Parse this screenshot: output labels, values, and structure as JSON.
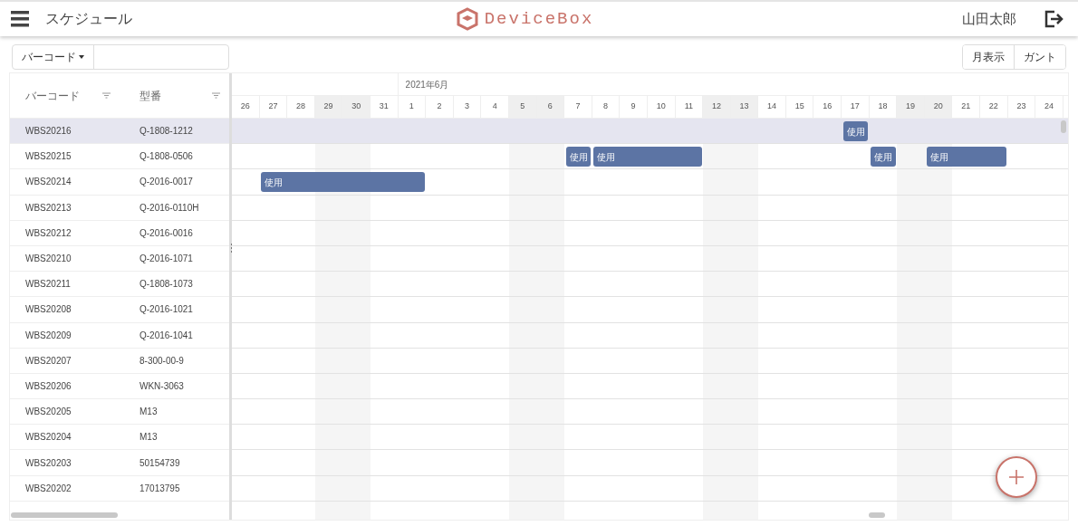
{
  "header": {
    "title": "スケジュール",
    "logo": "DeviceBox",
    "user": "山田太郎"
  },
  "toolbar": {
    "filter_dropdown": "バーコード",
    "view_buttons": [
      {
        "label": "月表示",
        "selected": false
      },
      {
        "label": "ガント",
        "selected": false
      }
    ]
  },
  "table": {
    "columns": [
      "バーコード",
      "型番"
    ],
    "month": "2021年6月",
    "days": [
      {
        "label": "26",
        "weekend": false
      },
      {
        "label": "27",
        "weekend": false
      },
      {
        "label": "28",
        "weekend": false
      },
      {
        "label": "29",
        "weekend": true
      },
      {
        "label": "30",
        "weekend": true
      },
      {
        "label": "31",
        "weekend": false
      },
      {
        "label": "1",
        "weekend": false
      },
      {
        "label": "2",
        "weekend": false
      },
      {
        "label": "3",
        "weekend": false
      },
      {
        "label": "4",
        "weekend": false
      },
      {
        "label": "5",
        "weekend": true
      },
      {
        "label": "6",
        "weekend": true
      },
      {
        "label": "7",
        "weekend": false
      },
      {
        "label": "8",
        "weekend": false
      },
      {
        "label": "9",
        "weekend": false
      },
      {
        "label": "10",
        "weekend": false
      },
      {
        "label": "11",
        "weekend": false
      },
      {
        "label": "12",
        "weekend": true
      },
      {
        "label": "13",
        "weekend": true
      },
      {
        "label": "14",
        "weekend": false
      },
      {
        "label": "15",
        "weekend": false
      },
      {
        "label": "16",
        "weekend": false
      },
      {
        "label": "17",
        "weekend": false
      },
      {
        "label": "18",
        "weekend": false
      },
      {
        "label": "19",
        "weekend": true
      },
      {
        "label": "20",
        "weekend": true
      },
      {
        "label": "21",
        "weekend": false
      },
      {
        "label": "22",
        "weekend": false
      },
      {
        "label": "23",
        "weekend": false
      },
      {
        "label": "24",
        "weekend": false
      }
    ],
    "rows": [
      {
        "barcode": "WBS20216",
        "model": "Q-1808-1212",
        "selected": true,
        "cells": [
          {
            "kind": "empty"
          },
          {
            "kind": "empty"
          },
          {
            "kind": "empty"
          },
          {
            "kind": "empty"
          },
          {
            "kind": "empty"
          },
          {
            "kind": "empty"
          },
          {
            "kind": "empty"
          },
          {
            "kind": "empty"
          },
          {
            "kind": "empty"
          },
          {
            "kind": "empty"
          },
          {
            "kind": "empty"
          },
          {
            "kind": "empty"
          },
          {
            "kind": "empty"
          },
          {
            "kind": "empty"
          },
          {
            "kind": "empty"
          },
          {
            "kind": "empty"
          },
          {
            "kind": "empty"
          },
          {
            "kind": "empty"
          },
          {
            "kind": "empty"
          },
          {
            "kind": "empty"
          },
          {
            "kind": "empty"
          },
          {
            "kind": "empty"
          },
          {
            "kind": "start",
            "label": "使用"
          },
          {
            "kind": "empty"
          },
          {
            "kind": "empty"
          },
          {
            "kind": "empty"
          },
          {
            "kind": "empty"
          },
          {
            "kind": "empty"
          },
          {
            "kind": "empty"
          },
          {
            "kind": "empty"
          }
        ]
      },
      {
        "barcode": "WBS20215",
        "model": "Q-1808-0506",
        "selected": false,
        "cells": [
          {
            "kind": "empty"
          },
          {
            "kind": "empty"
          },
          {
            "kind": "empty"
          },
          {
            "kind": "empty"
          },
          {
            "kind": "empty"
          },
          {
            "kind": "empty"
          },
          {
            "kind": "empty"
          },
          {
            "kind": "empty"
          },
          {
            "kind": "empty"
          },
          {
            "kind": "empty"
          },
          {
            "kind": "empty"
          },
          {
            "kind": "empty"
          },
          {
            "kind": "start",
            "label": "使用"
          },
          {
            "kind": "start",
            "label": "使用"
          },
          {
            "kind": "continue"
          },
          {
            "kind": "continue"
          },
          {
            "kind": "continue"
          },
          {
            "kind": "empty"
          },
          {
            "kind": "empty"
          },
          {
            "kind": "empty"
          },
          {
            "kind": "empty"
          },
          {
            "kind": "empty"
          },
          {
            "kind": "empty"
          },
          {
            "kind": "start",
            "label": "使用"
          },
          {
            "kind": "empty"
          },
          {
            "kind": "start",
            "label": "使用"
          },
          {
            "kind": "continue"
          },
          {
            "kind": "continue"
          },
          {
            "kind": "empty"
          },
          {
            "kind": "empty"
          }
        ]
      },
      {
        "barcode": "WBS20214",
        "model": "Q-2016-0017",
        "selected": false,
        "cells": [
          {
            "kind": "empty"
          },
          {
            "kind": "start",
            "label": "使用"
          },
          {
            "kind": "continue"
          },
          {
            "kind": "continue"
          },
          {
            "kind": "continue"
          },
          {
            "kind": "continue"
          },
          {
            "kind": "continue"
          },
          {
            "kind": "empty"
          },
          {
            "kind": "empty"
          },
          {
            "kind": "empty"
          },
          {
            "kind": "empty"
          },
          {
            "kind": "empty"
          },
          {
            "kind": "empty"
          },
          {
            "kind": "empty"
          },
          {
            "kind": "empty"
          },
          {
            "kind": "empty"
          },
          {
            "kind": "empty"
          },
          {
            "kind": "empty"
          },
          {
            "kind": "empty"
          },
          {
            "kind": "empty"
          },
          {
            "kind": "empty"
          },
          {
            "kind": "empty"
          },
          {
            "kind": "empty"
          },
          {
            "kind": "empty"
          },
          {
            "kind": "empty"
          },
          {
            "kind": "empty"
          },
          {
            "kind": "empty"
          },
          {
            "kind": "empty"
          },
          {
            "kind": "empty"
          },
          {
            "kind": "empty"
          }
        ]
      },
      {
        "barcode": "WBS20213",
        "model": "Q-2016-0110H",
        "selected": false
      },
      {
        "barcode": "WBS20212",
        "model": "Q-2016-0016",
        "selected": false
      },
      {
        "barcode": "WBS20210",
        "model": "Q-2016-1071",
        "selected": false
      },
      {
        "barcode": "WBS20211",
        "model": "Q-1808-1073",
        "selected": false
      },
      {
        "barcode": "WBS20208",
        "model": "Q-2016-1021",
        "selected": false
      },
      {
        "barcode": "WBS20209",
        "model": "Q-2016-1041",
        "selected": false
      },
      {
        "barcode": "WBS20207",
        "model": "8-300-00-9",
        "selected": false
      },
      {
        "barcode": "WBS20206",
        "model": "WKN-3063",
        "selected": false
      },
      {
        "barcode": "WBS20205",
        "model": "M13",
        "selected": false
      },
      {
        "barcode": "WBS20204",
        "model": "M13",
        "selected": false
      },
      {
        "barcode": "WBS20203",
        "model": "50154739",
        "selected": false
      },
      {
        "barcode": "WBS20202",
        "model": "17013795",
        "selected": false
      }
    ]
  }
}
